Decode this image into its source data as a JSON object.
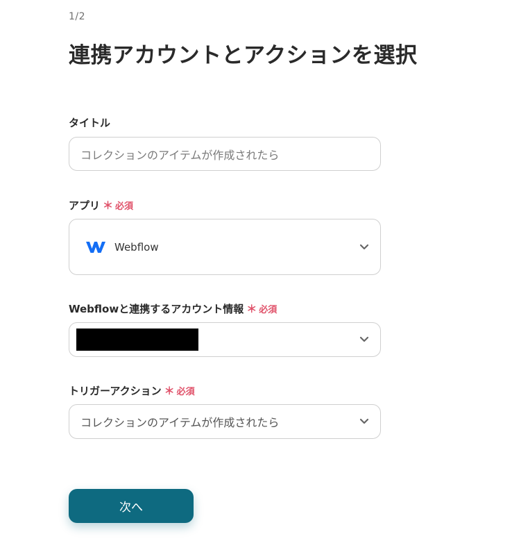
{
  "header": {
    "step": "1/2",
    "title": "連携アカウントとアクションを選択"
  },
  "required_mark": "＊",
  "required_text": "必須",
  "fields": {
    "title": {
      "label": "タイトル",
      "value": "コレクションのアイテムが作成されたら"
    },
    "app": {
      "label": "アプリ",
      "selected": "Webflow",
      "icon": "webflow-logo"
    },
    "account": {
      "label": "Webflowと連携するアカウント情報"
    },
    "trigger": {
      "label": "トリガーアクション",
      "selected": "コレクションのアイテムが作成されたら"
    }
  },
  "actions": {
    "next_label": "次へ"
  },
  "colors": {
    "primary": "#0e6a80",
    "required": "#e0526a",
    "webflow_blue": "#146ef5"
  }
}
